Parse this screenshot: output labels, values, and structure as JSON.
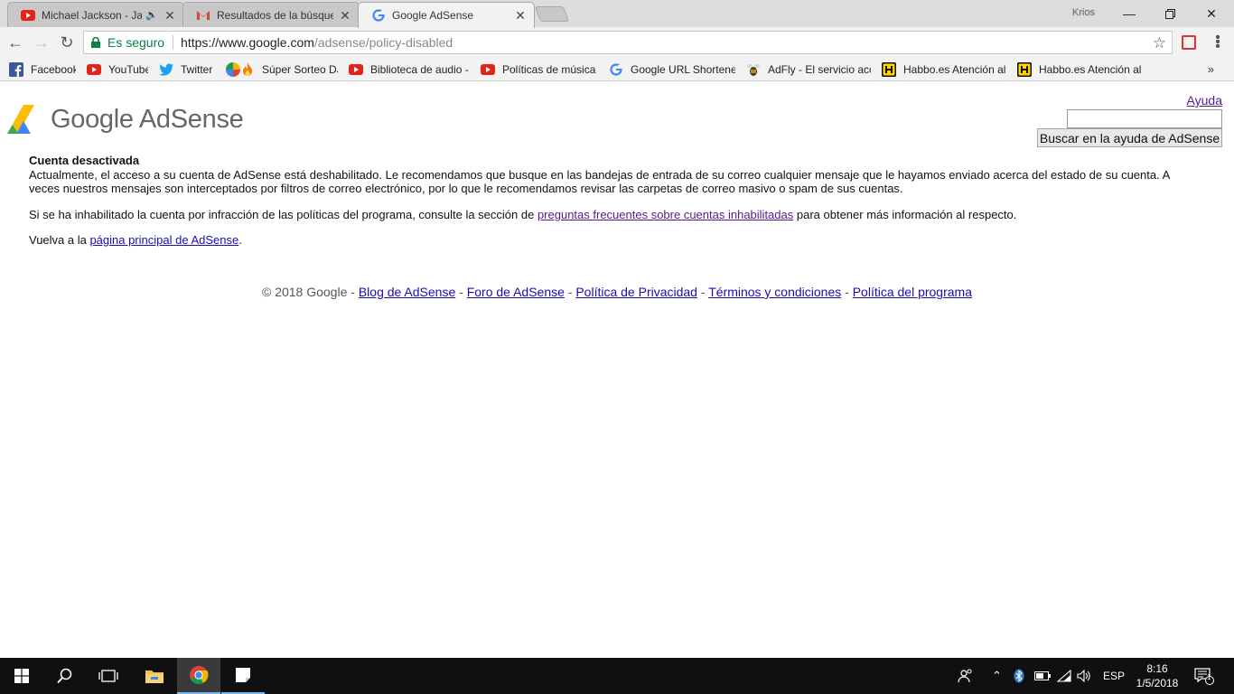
{
  "browser": {
    "tabs": [
      {
        "title": "Michael Jackson - Jam",
        "favicon": "youtube-icon",
        "audio": true
      },
      {
        "title": "Resultados de la búsqueda",
        "favicon": "gmail-icon"
      },
      {
        "title": "Google AdSense",
        "favicon": "google-icon",
        "active": true
      }
    ],
    "profile_name": "Krios",
    "security_label": "Es seguro",
    "url_host": "https://www.google.com",
    "url_path": "/adsense/policy-disabled",
    "bookmarks": [
      {
        "label": "Facebook",
        "icon": "facebook-icon"
      },
      {
        "label": "YouTube",
        "icon": "youtube-icon"
      },
      {
        "label": "Twitter",
        "icon": "twitter-icon"
      },
      {
        "label": "",
        "icon": "pinwheel-icon"
      },
      {
        "label": "Súper Sorteo DJ M",
        "icon": "fire-icon"
      },
      {
        "label": "Biblioteca de audio -",
        "icon": "youtube-icon"
      },
      {
        "label": "Políticas de música -",
        "icon": "youtube-icon"
      },
      {
        "label": "Google URL Shortene",
        "icon": "google-icon"
      },
      {
        "label": "AdFly - El servicio acc",
        "icon": "adfly-icon"
      },
      {
        "label": "Habbo.es Atención al",
        "icon": "habbo-icon"
      },
      {
        "label": "Habbo.es Atención al",
        "icon": "habbo-icon"
      }
    ],
    "bookmarks_more": "»"
  },
  "page": {
    "logo_text": "Google AdSense",
    "help_link": "Ayuda",
    "search_value": "",
    "search_button": "Buscar en la ayuda de AdSense",
    "heading": "Cuenta desactivada",
    "para1": "Actualmente, el acceso a su cuenta de AdSense está deshabilitado. Le recomendamos que busque en las bandejas de entrada de su correo cualquier mensaje que le hayamos enviado acerca del estado de su cuenta. A veces nuestros mensajes son interceptados por filtros de correo electrónico, por lo que le recomendamos revisar las carpetas de correo masivo o spam de sus cuentas.",
    "para2_before": "Si se ha inhabilitado la cuenta por infracción de las políticas del programa, consulte la sección de ",
    "para2_link": "preguntas frecuentes sobre cuentas inhabilitadas",
    "para2_after": " para obtener más información al respecto.",
    "para3_before": "Vuelva a la ",
    "para3_link": "página principal de AdSense",
    "para3_after": ".",
    "footer": {
      "copyright": "© 2018 Google",
      "sep": " - ",
      "links": [
        "Blog de AdSense",
        "Foro de AdSense",
        "Política de Privacidad",
        "Términos y condiciones",
        "Política del programa"
      ]
    }
  },
  "taskbar": {
    "language": "ESP",
    "time": "8:16",
    "date": "1/5/2018",
    "notification_count": "1"
  },
  "colors": {
    "link": "#1a0dab",
    "visited": "#551a8b",
    "secure": "#0b8043",
    "taskbar": "#101010"
  }
}
